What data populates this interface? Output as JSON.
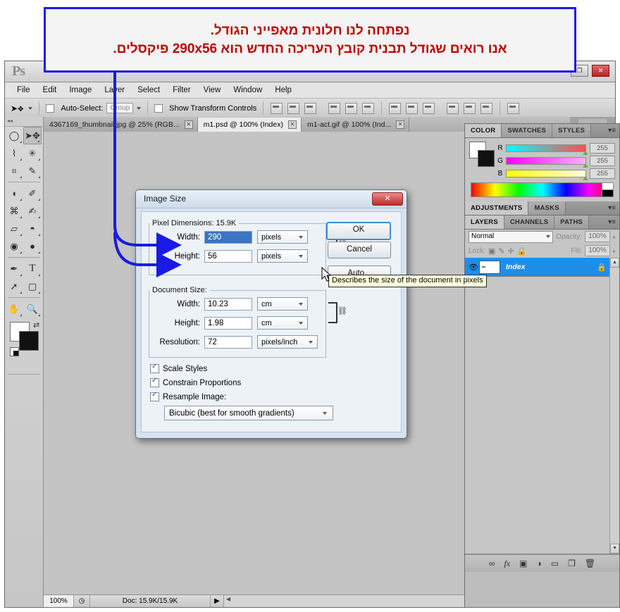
{
  "callout": {
    "line1": "נפתחה לנו חלונית מאפייני הגודל.",
    "line2": "אנו רואים שגודל תבנית קובץ העריכה החדש הוא 290x56 פיקסלים.",
    "border_color": "#1a1ae6",
    "text_color": "#c00000"
  },
  "app": {
    "logo": "Ps",
    "restore_label": "❐",
    "close_label": "✕",
    "menus": [
      "File",
      "Edit",
      "Image",
      "Layer",
      "Select",
      "Filter",
      "View",
      "Window",
      "Help"
    ]
  },
  "options_bar": {
    "tool_icon": "move-tool",
    "auto_select_label": "Auto-Select:",
    "auto_select_value": "Group",
    "show_transform_label": "Show Transform Controls"
  },
  "tabs": [
    {
      "title": "4367169_thumbnail.jpg @ 25% (RGB...",
      "active": false,
      "close": "✕"
    },
    {
      "title": "m1.psd @ 100% (Index)",
      "active": true,
      "close": "✕"
    },
    {
      "title": "m1-act.gif @ 100% (Ind...",
      "active": false,
      "close": "✕"
    }
  ],
  "tools": [
    "marquee-tool",
    "move-tool",
    "lasso-tool",
    "magic-wand-tool",
    "crop-tool",
    "eyedropper-tool",
    "healing-brush-tool",
    "brush-tool",
    "clone-stamp-tool",
    "history-brush-tool",
    "eraser-tool",
    "paint-bucket-tool",
    "blur-tool",
    "dodge-tool",
    "pen-tool",
    "type-tool",
    "path-selection-tool",
    "rectangle-tool",
    "hand-tool",
    "zoom-tool"
  ],
  "tool_glyphs": [
    "◯",
    "➤",
    "⌇",
    "✳",
    "⌗",
    "✎",
    "◖",
    "✐",
    "⌘",
    "✍",
    "▱",
    "◓",
    "◉",
    "●",
    "✒",
    "T",
    "➚",
    "▢",
    "✋",
    "🔍"
  ],
  "status_bar": {
    "zoom": "100%",
    "clock_icon": "clock-icon",
    "doc_info": "Doc: 15.9K/15.9K",
    "arrow": "▶",
    "scroll_left": "◀",
    "scroll_right": "▶"
  },
  "dock": {
    "icons": [
      "Mb",
      "history-icon"
    ]
  },
  "color_panel": {
    "tabs": [
      "COLOR",
      "SWATCHES",
      "STYLES"
    ],
    "active_tab": "COLOR",
    "menu_icon": "panel-menu-icon",
    "channels": [
      {
        "label": "R",
        "value": "255"
      },
      {
        "label": "G",
        "value": "255"
      },
      {
        "label": "B",
        "value": "255"
      }
    ],
    "foreground": "#ffffff",
    "background": "#111111"
  },
  "adjustments_panel": {
    "tabs": [
      "ADJUSTMENTS",
      "MASKS"
    ],
    "active_tab": "ADJUSTMENTS",
    "menu_icon": "panel-menu-icon"
  },
  "layers_panel": {
    "tabs": [
      "LAYERS",
      "CHANNELS",
      "PATHS"
    ],
    "active_tab": "LAYERS",
    "menu_icon": "panel-menu-icon",
    "blend_mode": "Normal",
    "opacity_label": "Opacity:",
    "opacity_value": "100%",
    "lock_label": "Lock:",
    "fill_label": "Fill:",
    "fill_value": "100%",
    "lock_icons": [
      "lock-transparent-icon",
      "lock-pixels-icon",
      "lock-position-icon",
      "lock-all-icon"
    ],
    "layers": [
      {
        "name": "Index",
        "visible": true,
        "locked": true,
        "selected": true,
        "lock_glyph": "🔒",
        "eye_glyph": "👁"
      }
    ],
    "footer_icons": [
      "link-layers-icon",
      "layer-style-icon",
      "layer-mask-icon",
      "adjustment-layer-icon",
      "new-group-icon",
      "new-layer-icon",
      "delete-layer-icon"
    ],
    "footer_glyphs": [
      "∞",
      "fx",
      "▣",
      "◑",
      "▭",
      "❐",
      "🗑"
    ],
    "selected_color": "#1e8fe8"
  },
  "dialog": {
    "title": "Image Size",
    "close_label": "✕",
    "pixel_dimensions": {
      "legend": "Pixel Dimensions:  15.9K",
      "width_label": "Width:",
      "width_value": "290",
      "width_unit": "pixels",
      "height_label": "Height:",
      "height_value": "56",
      "height_unit": "pixels"
    },
    "document_size": {
      "legend": "Document Size:",
      "width_label": "Width:",
      "width_value": "10.23",
      "width_unit": "cm",
      "height_label": "Height:",
      "height_value": "1.98",
      "height_unit": "cm",
      "resolution_label": "Resolution:",
      "resolution_value": "72",
      "resolution_unit": "pixels/inch"
    },
    "buttons": {
      "ok": "OK",
      "cancel": "Cancel",
      "auto": "Auto..."
    },
    "checkboxes": [
      {
        "label": "Scale Styles",
        "checked": true
      },
      {
        "label": "Constrain Proportions",
        "checked": true
      },
      {
        "label": "Resample Image:",
        "checked": true
      }
    ],
    "resample_method": "Bicubic (best for smooth gradients)"
  },
  "tooltip": {
    "text": "Describes the size of the document in pixels"
  },
  "cursor": {
    "icon": "mouse-pointer-icon"
  }
}
